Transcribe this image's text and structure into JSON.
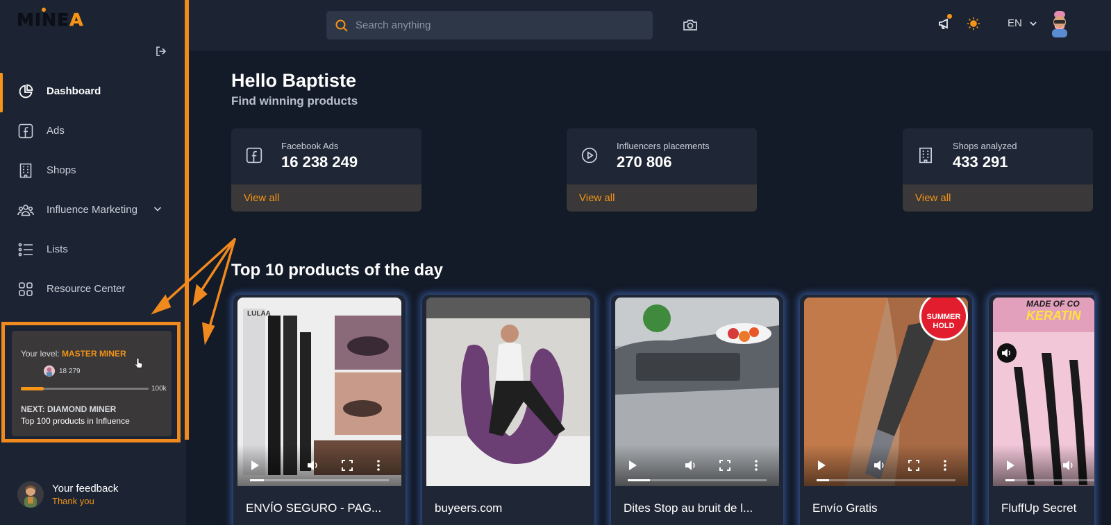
{
  "app": {
    "logo": {
      "pre": "MINE",
      "accent": "A"
    },
    "brand_color": "#f59417"
  },
  "sidebar": {
    "items": [
      {
        "label": "Dashboard",
        "icon": "pie-chart-icon",
        "active": true
      },
      {
        "label": "Ads",
        "icon": "facebook-icon"
      },
      {
        "label": "Shops",
        "icon": "building-icon"
      },
      {
        "label": "Influence Marketing",
        "icon": "users-icon",
        "has_submenu": true
      },
      {
        "label": "Lists",
        "icon": "list-icon"
      },
      {
        "label": "Resource Center",
        "icon": "grid-icon"
      }
    ]
  },
  "level": {
    "prefix": "Your level: ",
    "value": "MASTER MINER",
    "points": "18 279",
    "max": "100k",
    "progress_fraction": 0.18,
    "next": "NEXT: DIAMOND MINER",
    "goal": "Top 100 products in Influence"
  },
  "feedback": {
    "title": "Your feedback",
    "subtitle": "Thank you"
  },
  "topbar": {
    "search_placeholder": "Search anything",
    "language": "EN"
  },
  "main": {
    "greeting": "Hello Baptiste",
    "subtitle": "Find winning products",
    "stats": [
      {
        "label": "Facebook Ads",
        "value": "16 238 249",
        "link": "View all",
        "icon": "facebook-icon"
      },
      {
        "label": "Influencers placements",
        "value": "270 806",
        "link": "View all",
        "icon": "play-circle-icon"
      },
      {
        "label": "Shops analyzed",
        "value": "433 291",
        "link": "View all",
        "icon": "building-icon"
      }
    ],
    "section_title": "Top 10 products of the day",
    "products": [
      {
        "title": "ENVÍO SEGURO - PAG...",
        "progress_fraction": 0.1
      },
      {
        "title": "buyeers.com",
        "progress_fraction": 0
      },
      {
        "title": "Dites Stop au bruit de l...",
        "progress_fraction": 0.16
      },
      {
        "title": "Envío Gratis",
        "progress_fraction": 0.09
      },
      {
        "title": "FluffUp Secret",
        "progress_fraction": 0.1
      }
    ],
    "product_overlay_text": {
      "p1_brand": "LULAA",
      "p4_badge": "SUMMER HOLD",
      "p5_banner": "MADE OF CO",
      "p5_banner2": "KERATIN"
    }
  }
}
